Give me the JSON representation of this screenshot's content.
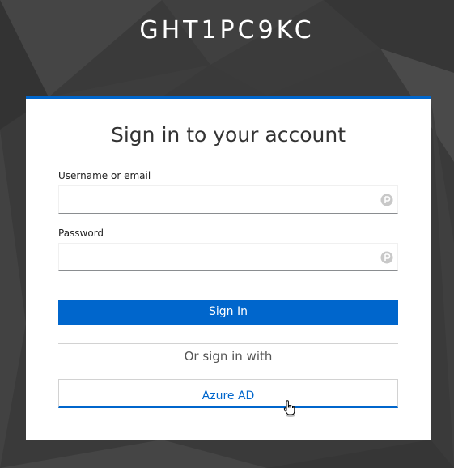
{
  "realm": {
    "title": "GHT1PC9KC"
  },
  "login": {
    "heading": "Sign in to your account",
    "username_label": "Username or email",
    "username_value": "",
    "password_label": "Password",
    "password_value": "",
    "signin_label": "Sign In",
    "or_text": "Or sign in with",
    "providers": [
      {
        "label": "Azure AD"
      }
    ]
  },
  "colors": {
    "accent": "#0066cc",
    "background": "#3c3c3c",
    "card": "#ffffff"
  },
  "icons": {
    "password_manager": "password-manager-icon",
    "cursor": "hand-pointer-icon"
  }
}
